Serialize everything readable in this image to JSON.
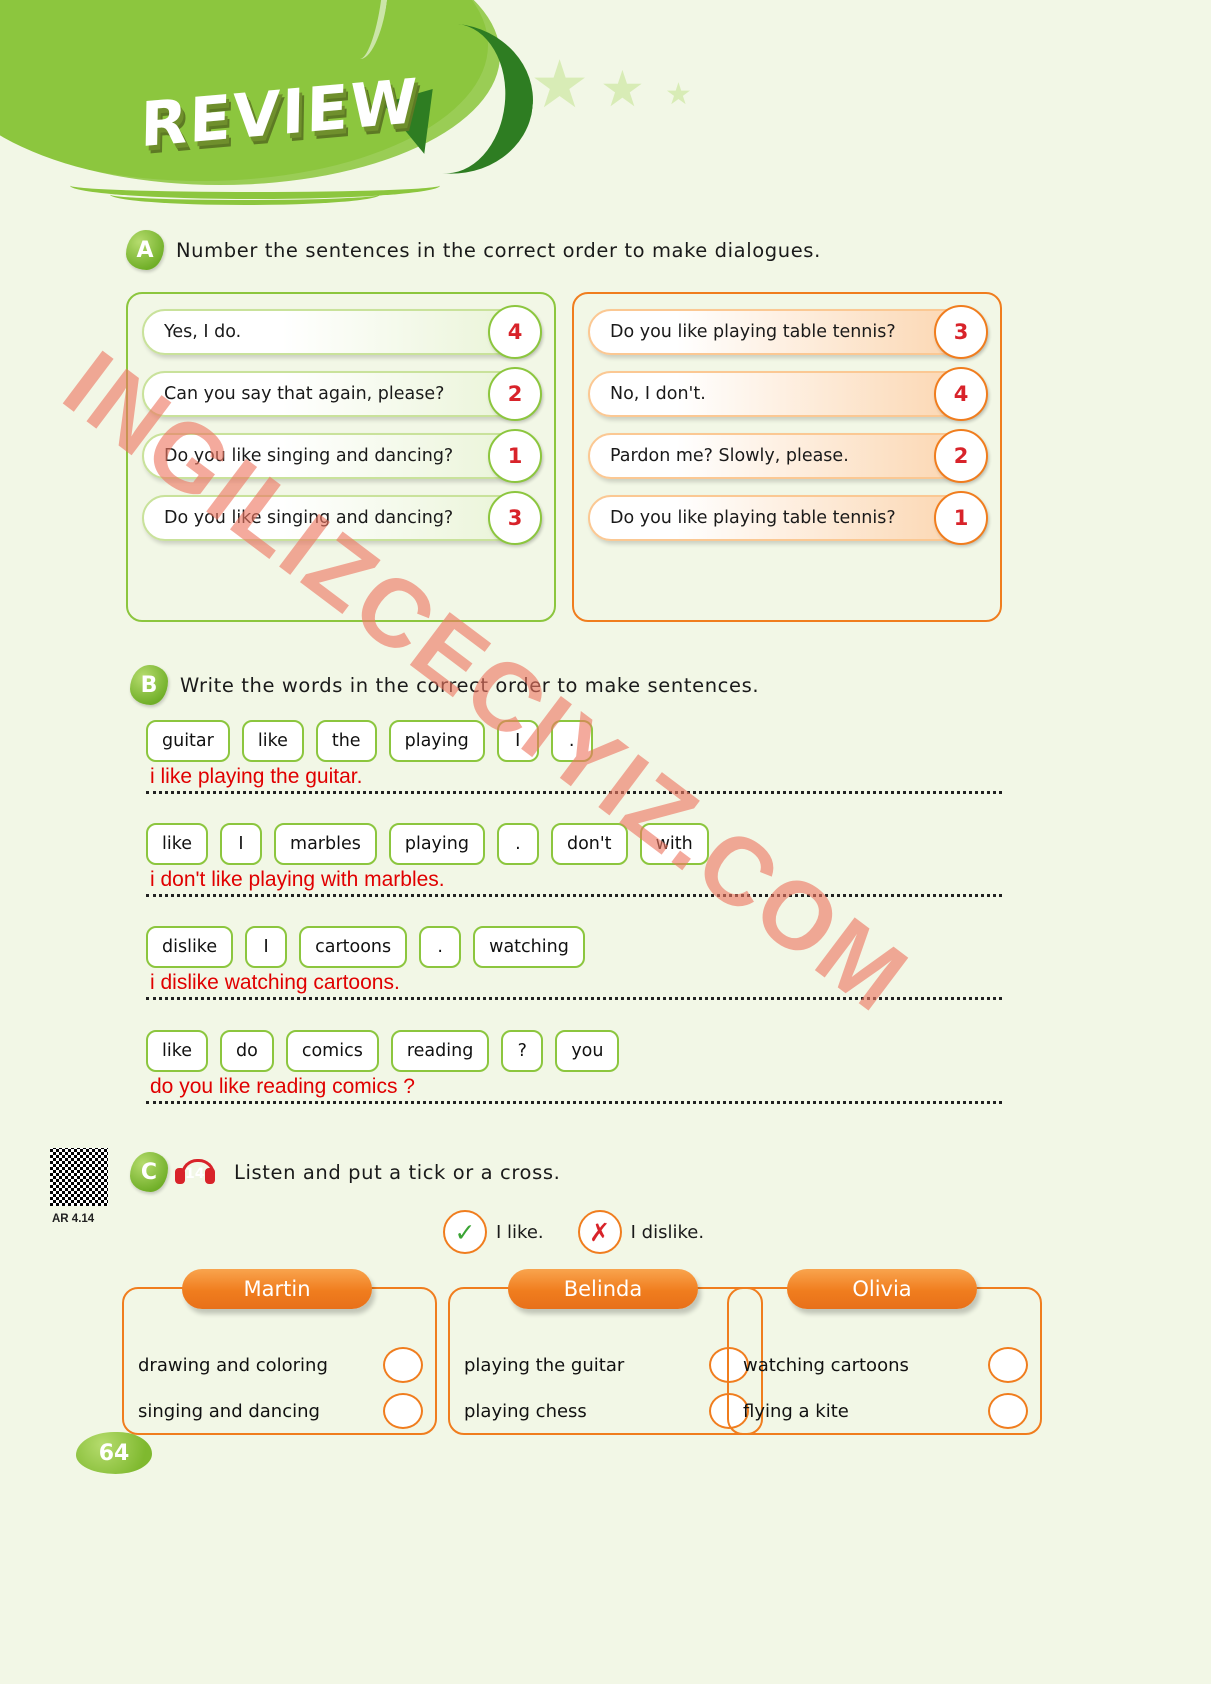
{
  "header": {
    "title": "REVIEW",
    "stars": [
      "★",
      "★",
      "★"
    ]
  },
  "watermark": "INGILIZCECIYIZ.COM",
  "page_number": "64",
  "exercise_a": {
    "letter": "A",
    "instruction": "Number the sentences in the correct order to make dialogues.",
    "left_column": [
      {
        "text": "Yes, I do.",
        "number": "4"
      },
      {
        "text": "Can you say that again, please?",
        "number": "2"
      },
      {
        "text": "Do you like singing and dancing?",
        "number": "1"
      },
      {
        "text": "Do you like singing and dancing?",
        "number": "3"
      }
    ],
    "right_column": [
      {
        "text": "Do you like playing table tennis?",
        "number": "3"
      },
      {
        "text": "No, I don't.",
        "number": "4"
      },
      {
        "text": "Pardon me? Slowly, please.",
        "number": "2"
      },
      {
        "text": "Do you like playing table tennis?",
        "number": "1"
      }
    ]
  },
  "exercise_b": {
    "letter": "B",
    "instruction": "Write the words in the correct order to make sentences.",
    "rows": [
      {
        "chips": [
          "guitar",
          "like",
          "the",
          "playing",
          "I",
          "."
        ],
        "answer": "i like playing the guitar."
      },
      {
        "chips": [
          "like",
          "I",
          "marbles",
          "playing",
          ".",
          "don't",
          "with"
        ],
        "answer": "i don't like playing with marbles."
      },
      {
        "chips": [
          "dislike",
          "I",
          "cartoons",
          ".",
          "watching"
        ],
        "answer": "i dislike watching cartoons."
      },
      {
        "chips": [
          "like",
          "do",
          "comics",
          "reading",
          "?",
          "you"
        ],
        "answer": "do you like reading comics ?"
      }
    ]
  },
  "exercise_c": {
    "letter": "C",
    "track_number": "14",
    "instruction": "Listen and put a tick or a cross.",
    "qr_label": "AR 4.14",
    "legend": [
      {
        "mark": "✓",
        "label": "I like."
      },
      {
        "mark": "✗",
        "label": "I dislike."
      }
    ],
    "cards": [
      {
        "name": "Martin",
        "items": [
          "drawing and coloring",
          "singing and dancing"
        ]
      },
      {
        "name": "Belinda",
        "items": [
          "playing the guitar",
          "playing chess"
        ]
      },
      {
        "name": "Olivia",
        "items": [
          "watching cartoons",
          "flying a kite"
        ]
      }
    ]
  },
  "colors": {
    "green": "#8cc63e",
    "orange": "#f07d1e",
    "red": "#d8232a",
    "answer_red": "#e00000",
    "page_bg": "#f2f7e6"
  }
}
